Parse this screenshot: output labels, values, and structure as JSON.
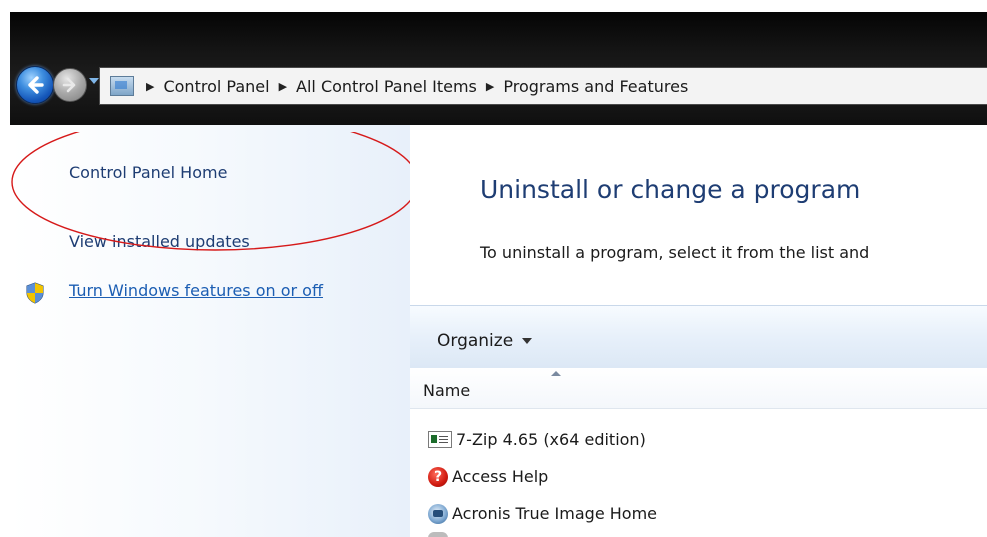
{
  "address_bar": {
    "breadcrumbs": [
      "Control Panel",
      "All Control Panel Items",
      "Programs and Features"
    ]
  },
  "left_pane": {
    "home_link": "Control Panel Home",
    "updates_link": "View installed updates",
    "features_link": "Turn Windows features on or off"
  },
  "main": {
    "title": "Uninstall or change a program",
    "description": "To uninstall a program, select it from the list and",
    "toolbar": {
      "organize_label": "Organize"
    },
    "columns": {
      "name": "Name"
    },
    "programs": [
      {
        "name": "7-Zip 4.65 (x64 edition)",
        "icon": "7zip-icon"
      },
      {
        "name": "Access Help",
        "icon": "help-icon"
      },
      {
        "name": "Acronis True Image Home",
        "icon": "acronis-icon"
      }
    ]
  },
  "colors": {
    "link": "#1e3d73",
    "annotation_ellipse": "#d61a1a"
  }
}
